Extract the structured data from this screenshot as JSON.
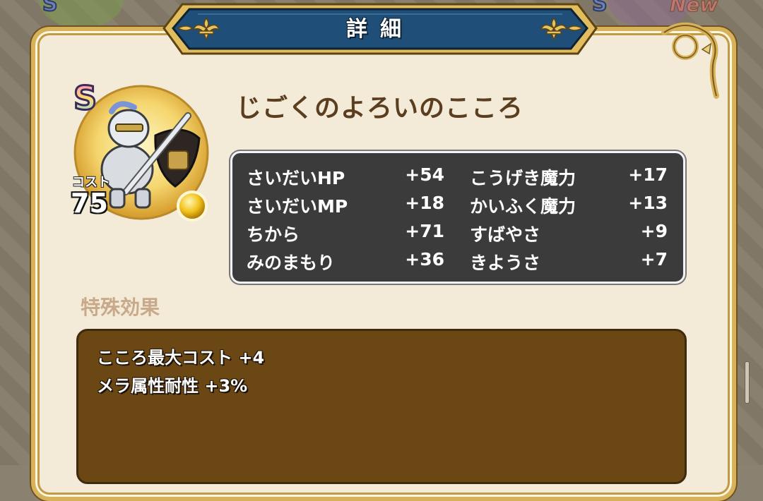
{
  "header": {
    "title": "詳細"
  },
  "background": {
    "rank_left": "S",
    "rank_right": "S",
    "new_badge": "New"
  },
  "item": {
    "rank": "S",
    "name": "じごくのよろいのこころ",
    "cost_label": "コスト",
    "cost_value": "75",
    "icon": "armored-knight-icon",
    "orb_color": "#f2c21a"
  },
  "stats": [
    {
      "left_name": "さいだいHP",
      "left_value": "+54",
      "right_name": "こうげき魔力",
      "right_value": "+17"
    },
    {
      "left_name": "さいだいMP",
      "left_value": "+18",
      "right_name": "かいふく魔力",
      "right_value": "+13"
    },
    {
      "left_name": "ちから",
      "left_value": "+71",
      "right_name": "すばやさ",
      "right_value": "+9"
    },
    {
      "left_name": "みのまもり",
      "left_value": "+36",
      "right_name": "きようさ",
      "right_value": "+7"
    }
  ],
  "effects": {
    "heading": "特殊効果",
    "lines": [
      "こころ最大コスト +4",
      "メラ属性耐性 +3%"
    ]
  },
  "colors": {
    "banner": "#1f4f78",
    "gold": "#d8b25a",
    "panel": "#f3ebd8",
    "stats_bg": "#3b3b3b",
    "effects_bg": "#6b4713",
    "name_text": "#5b3e20"
  }
}
